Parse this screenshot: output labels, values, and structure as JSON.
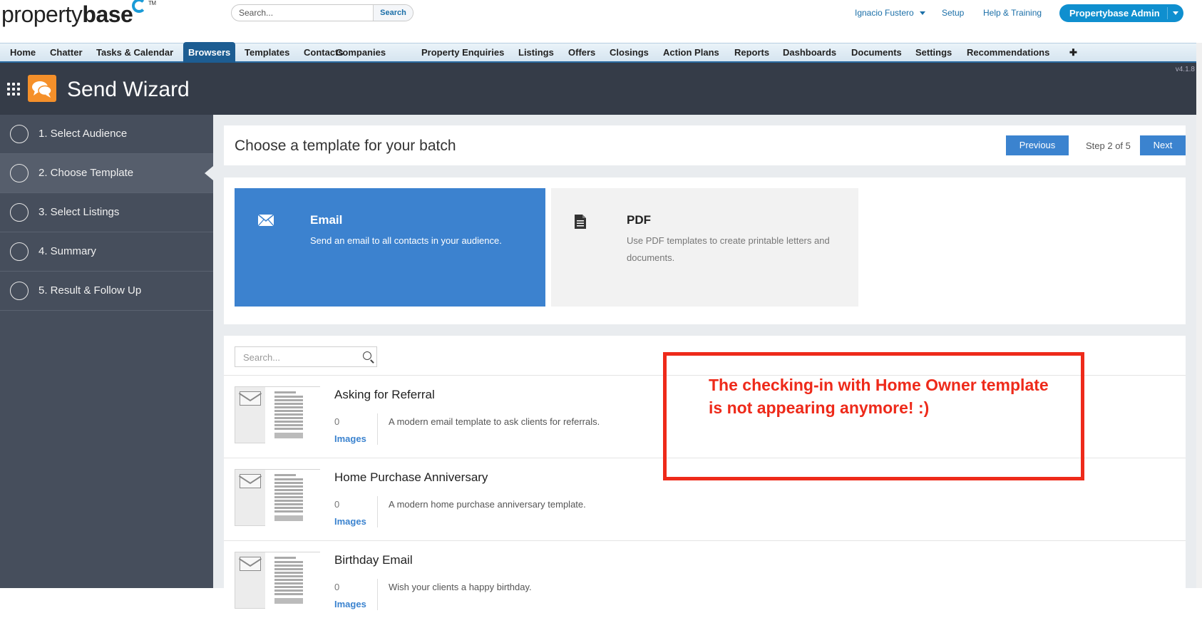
{
  "header": {
    "logo_light": "property",
    "logo_bold": "base",
    "logo_tm": "TM",
    "search_placeholder": "Search...",
    "search_button": "Search",
    "user_name": "Ignacio Fustero",
    "setup": "Setup",
    "help": "Help & Training",
    "admin_button": "Propertybase Admin"
  },
  "nav": {
    "tabs": [
      "Home",
      "Chatter",
      "Tasks & Calendar",
      "Browsers",
      "Templates",
      "Contacts",
      "Companies",
      "Property Enquiries",
      "Listings",
      "Offers",
      "Closings",
      "Action Plans",
      "Reports",
      "Dashboards",
      "Documents",
      "Settings",
      "Recommendations",
      "✚"
    ],
    "active": "Browsers"
  },
  "app": {
    "title": "Send Wizard",
    "version": "v4.1.8",
    "icon_color": "#f5902a"
  },
  "sidebar": {
    "steps": [
      "1. Select Audience",
      "2. Choose Template",
      "3. Select Listings",
      "4. Summary",
      "5. Result & Follow Up"
    ],
    "active_step": "2. Choose Template"
  },
  "main": {
    "heading": "Choose a template for your batch",
    "previous": "Previous",
    "step_counter": "Step 2 of 5",
    "next": "Next"
  },
  "template_types": {
    "email": {
      "icon": "envelope-icon",
      "title": "Email",
      "description": "Send an email to all contacts in your audience."
    },
    "pdf": {
      "icon": "document-icon",
      "title": "PDF",
      "description": "Use PDF templates to create printable letters and documents."
    }
  },
  "template_list": {
    "search_placeholder": "Search...",
    "rows": [
      {
        "title": "Asking for Referral",
        "count": "0",
        "images_label": "Images",
        "description": "A modern email template to ask clients for referrals."
      },
      {
        "title": "Home Purchase Anniversary",
        "count": "0",
        "images_label": "Images",
        "description": "A modern home purchase anniversary template."
      },
      {
        "title": "Birthday Email",
        "count": "0",
        "images_label": "Images",
        "description": "Wish your clients a happy birthday."
      }
    ]
  },
  "annotation": {
    "text": "The checking-in with Home Owner template is not appearing anymore! :)",
    "color": "#ee2a1a"
  },
  "colors": {
    "accent": "#3b83cf",
    "nav_active": "#1d5d92",
    "sidebar_bg": "#464e5c",
    "header_bg": "#353c48"
  }
}
